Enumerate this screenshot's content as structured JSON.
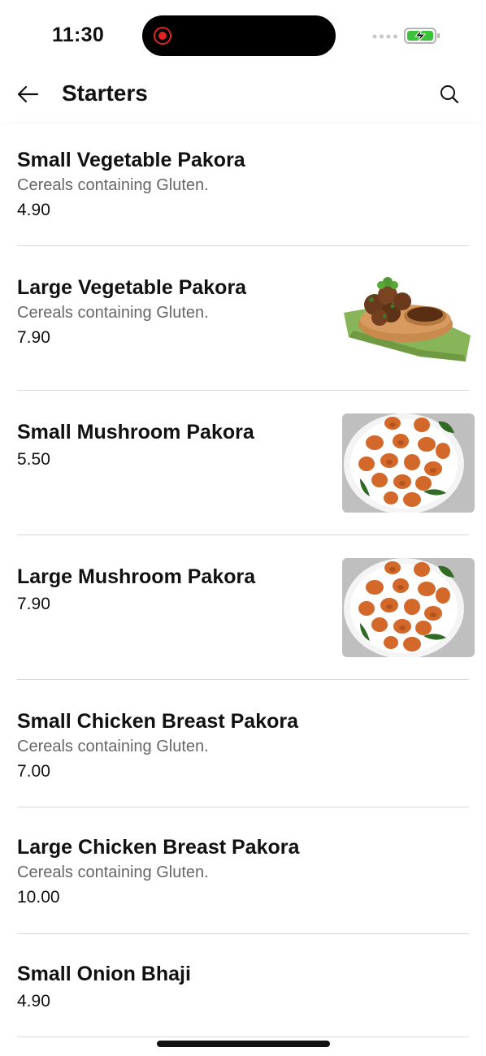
{
  "status_bar": {
    "time": "11:30"
  },
  "header": {
    "title": "Starters",
    "back_icon": "arrow-left-icon",
    "search_icon": "search-icon"
  },
  "menu_items": [
    {
      "name": "Small Vegetable Pakora",
      "allergen": "Cereals containing Gluten.",
      "price": "4.90",
      "image": ""
    },
    {
      "name": "Large Vegetable Pakora",
      "allergen": "Cereals containing Gluten.",
      "price": "7.90",
      "image": "pakora-bowl-photo"
    },
    {
      "name": "Small Mushroom Pakora",
      "allergen": "",
      "price": "5.50",
      "image": "mushroom-pakora-plate-photo"
    },
    {
      "name": "Large Mushroom Pakora",
      "allergen": "",
      "price": "7.90",
      "image": "mushroom-pakora-plate-photo"
    },
    {
      "name": "Small Chicken Breast Pakora",
      "allergen": "Cereals containing Gluten.",
      "price": "7.00",
      "image": ""
    },
    {
      "name": "Large Chicken Breast Pakora",
      "allergen": "Cereals containing Gluten.",
      "price": "10.00",
      "image": ""
    },
    {
      "name": "Small Onion Bhaji",
      "allergen": "",
      "price": "4.90",
      "image": ""
    }
  ],
  "colors": {
    "divider": "#d9d9d9",
    "allergen_text": "#666666",
    "battery_green": "#3cc13b",
    "record_red": "#e02424"
  }
}
